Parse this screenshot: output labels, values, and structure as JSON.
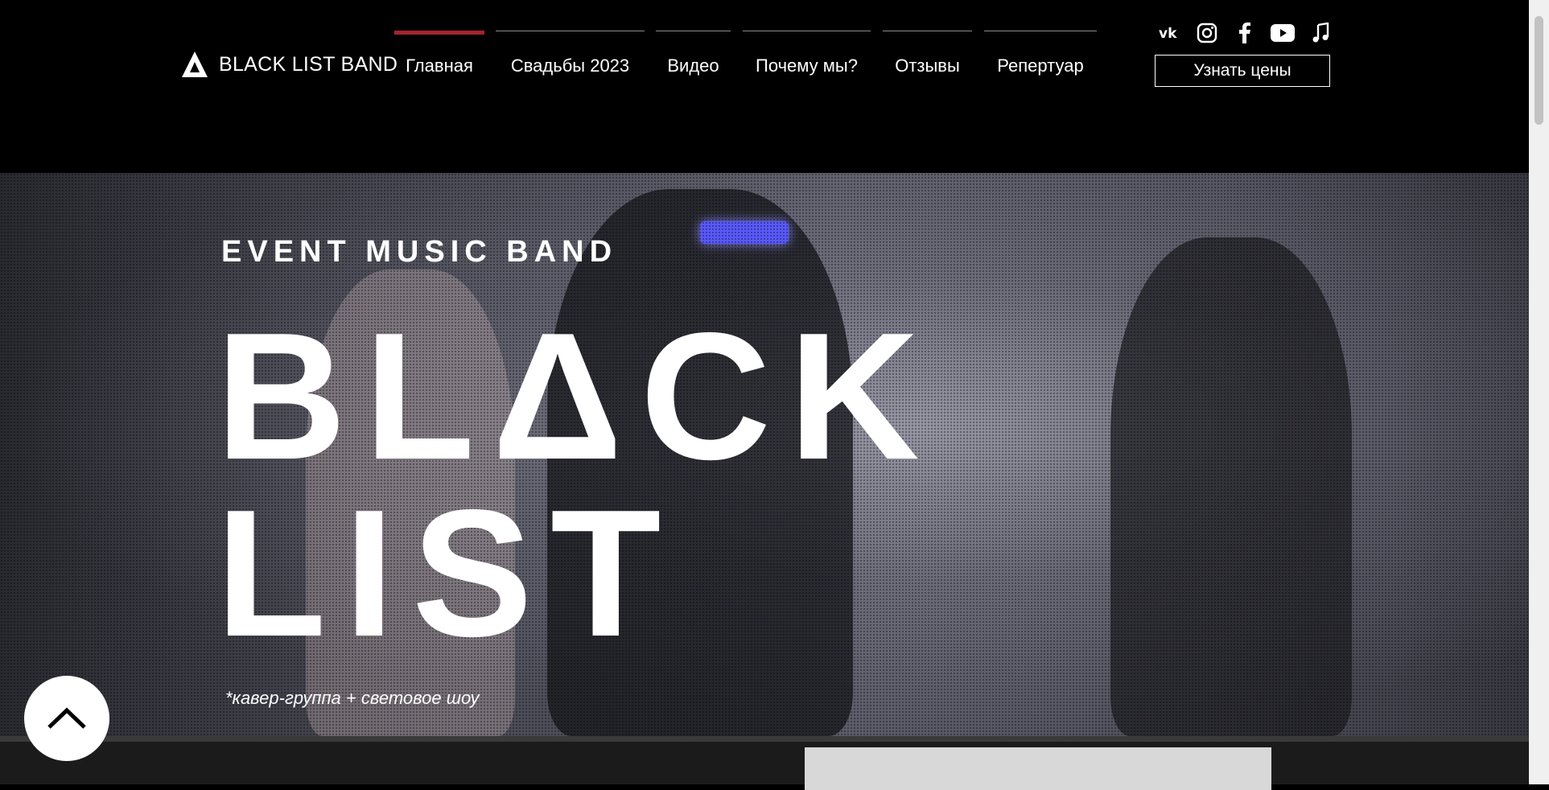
{
  "brand": {
    "name": "BLACK LIST BAND"
  },
  "nav": {
    "items": [
      {
        "label": "Главная",
        "active": true
      },
      {
        "label": "Свадьбы 2023",
        "active": false
      },
      {
        "label": "Видео",
        "active": false
      },
      {
        "label": "Почему мы?",
        "active": false
      },
      {
        "label": "Отзывы",
        "active": false
      },
      {
        "label": "Репертуар",
        "active": false
      }
    ]
  },
  "socials": [
    {
      "icon": "vk-icon"
    },
    {
      "icon": "instagram-icon"
    },
    {
      "icon": "facebook-icon"
    },
    {
      "icon": "youtube-icon"
    },
    {
      "icon": "music-note-icon"
    }
  ],
  "cta": {
    "label": "Узнать цены"
  },
  "hero": {
    "eyebrow": "EVENT MUSIC BAND",
    "title_line1": "BLΔCK",
    "title_line2": "LIST",
    "tagline": "*кавер-группа + световое шоу"
  },
  "colors": {
    "accent": "#a3262a",
    "background": "#000000",
    "text": "#ffffff"
  }
}
